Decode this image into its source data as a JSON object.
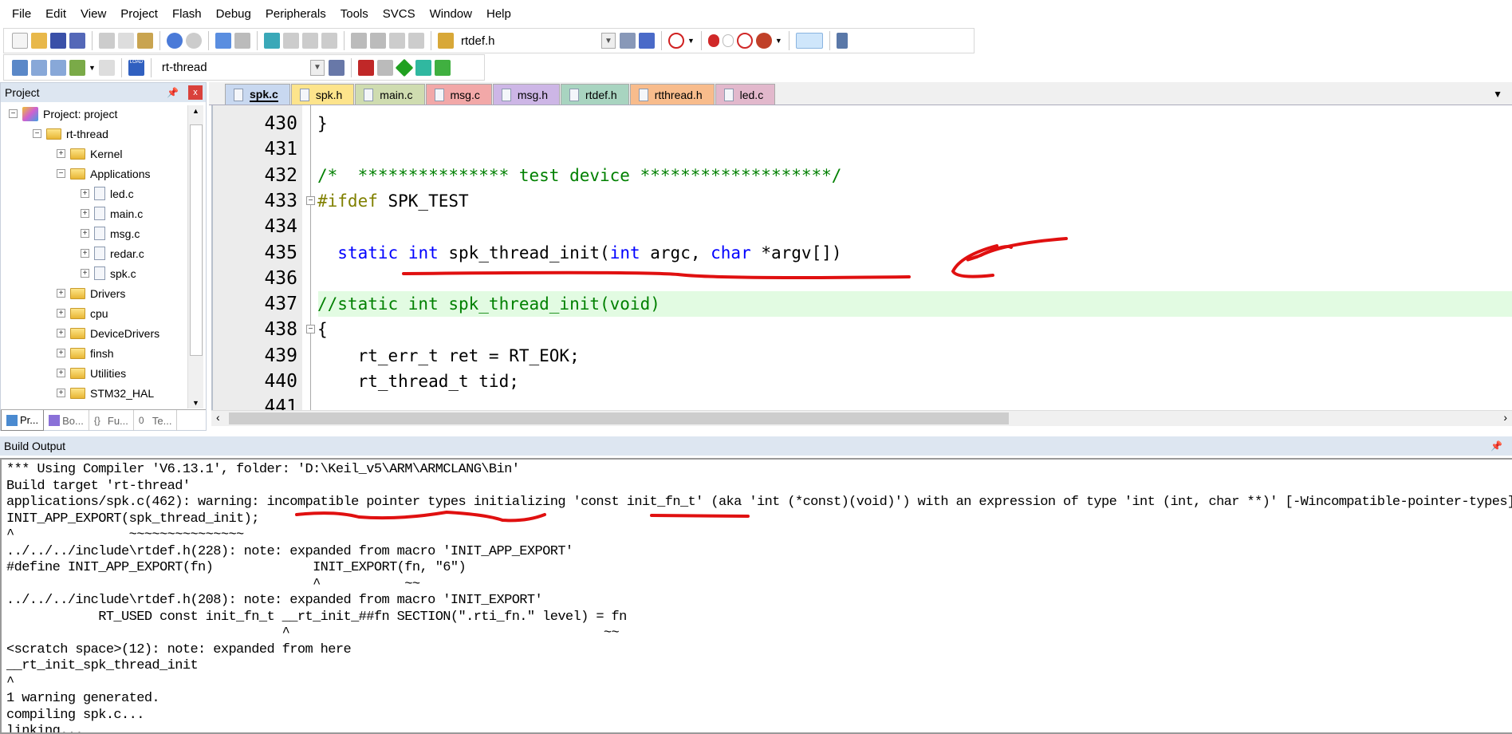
{
  "menu": [
    "File",
    "Edit",
    "View",
    "Project",
    "Flash",
    "Debug",
    "Peripherals",
    "Tools",
    "SVCS",
    "Window",
    "Help"
  ],
  "toolbar1": {
    "find_combo": "rtdef.h"
  },
  "toolbar2": {
    "target_combo": "rt-thread",
    "load_label": "LOAD"
  },
  "project_panel": {
    "title": "Project",
    "close": "x",
    "tree": [
      {
        "label": "Project: project",
        "level": 0,
        "expanded": true,
        "type": "project"
      },
      {
        "label": "rt-thread",
        "level": 1,
        "expanded": true,
        "type": "target"
      },
      {
        "label": "Kernel",
        "level": 2,
        "expanded": false,
        "type": "folder"
      },
      {
        "label": "Applications",
        "level": 2,
        "expanded": true,
        "type": "folder"
      },
      {
        "label": "led.c",
        "level": 3,
        "expanded": false,
        "type": "file"
      },
      {
        "label": "main.c",
        "level": 3,
        "expanded": false,
        "type": "file"
      },
      {
        "label": "msg.c",
        "level": 3,
        "expanded": false,
        "type": "file"
      },
      {
        "label": "redar.c",
        "level": 3,
        "expanded": false,
        "type": "file"
      },
      {
        "label": "spk.c",
        "level": 3,
        "expanded": false,
        "type": "file"
      },
      {
        "label": "Drivers",
        "level": 2,
        "expanded": false,
        "type": "folder"
      },
      {
        "label": "cpu",
        "level": 2,
        "expanded": false,
        "type": "folder"
      },
      {
        "label": "DeviceDrivers",
        "level": 2,
        "expanded": false,
        "type": "folder"
      },
      {
        "label": "finsh",
        "level": 2,
        "expanded": false,
        "type": "folder"
      },
      {
        "label": "Utilities",
        "level": 2,
        "expanded": false,
        "type": "folder"
      },
      {
        "label": "STM32_HAL",
        "level": 2,
        "expanded": false,
        "type": "folder"
      }
    ],
    "tabs": [
      {
        "label": "Pr...",
        "icon": "project-icon"
      },
      {
        "label": "Bo...",
        "icon": "books-icon"
      },
      {
        "label": "Fu...",
        "icon": "functions-icon",
        "glyph": "{}"
      },
      {
        "label": "Te...",
        "icon": "templates-icon",
        "glyph": "0"
      }
    ]
  },
  "editor": {
    "tabs": [
      {
        "label": "spk.c",
        "color": "#c8d8f0",
        "active": true
      },
      {
        "label": "spk.h",
        "color": "#fde48c"
      },
      {
        "label": "main.c",
        "color": "#cfdcb0"
      },
      {
        "label": "msg.c",
        "color": "#f2a8a8"
      },
      {
        "label": "msg.h",
        "color": "#cdb6e6"
      },
      {
        "label": "rtdef.h",
        "color": "#a8d4c0"
      },
      {
        "label": "rtthread.h",
        "color": "#f8bc8c"
      },
      {
        "label": "led.c",
        "color": "#e2b8cc"
      }
    ],
    "lines": [
      {
        "n": "430",
        "tokens": [
          {
            "t": "}"
          }
        ]
      },
      {
        "n": "431",
        "tokens": []
      },
      {
        "n": "432",
        "tokens": [
          {
            "t": "/*  *************** test device *******************/",
            "c": "cm"
          }
        ]
      },
      {
        "n": "433",
        "tokens": [
          {
            "t": "#ifdef",
            "c": "pp"
          },
          {
            "t": " SPK_TEST"
          }
        ],
        "fold": true
      },
      {
        "n": "434",
        "tokens": []
      },
      {
        "n": "435",
        "tokens": [
          {
            "t": "  "
          },
          {
            "t": "static",
            "c": "kw"
          },
          {
            "t": " "
          },
          {
            "t": "int",
            "c": "kw"
          },
          {
            "t": " spk_thread_init("
          },
          {
            "t": "int",
            "c": "kw"
          },
          {
            "t": " argc, "
          },
          {
            "t": "char",
            "c": "kw"
          },
          {
            "t": " *argv[])"
          }
        ]
      },
      {
        "n": "436",
        "tokens": []
      },
      {
        "n": "437",
        "tokens": [
          {
            "t": "//static int spk_thread_init(void)",
            "c": "cm"
          }
        ]
      },
      {
        "n": "438",
        "tokens": [
          {
            "t": "{"
          }
        ],
        "fold": true
      },
      {
        "n": "439",
        "tokens": [
          {
            "t": "    rt_err_t ret = RT_EOK;"
          }
        ]
      },
      {
        "n": "440",
        "tokens": [
          {
            "t": "    rt_thread_t tid;"
          }
        ]
      },
      {
        "n": "441",
        "tokens": []
      }
    ]
  },
  "build_output": {
    "title": "Build Output",
    "lines": [
      "*** Using Compiler 'V6.13.1', folder: 'D:\\Keil_v5\\ARM\\ARMCLANG\\Bin'",
      "Build target 'rt-thread'",
      "applications/spk.c(462): warning: incompatible pointer types initializing 'const init_fn_t' (aka 'int (*const)(void)') with an expression of type 'int (int, char **)' [-Wincompatible-pointer-types]",
      "INIT_APP_EXPORT(spk_thread_init);",
      "^               ~~~~~~~~~~~~~~~",
      "../../../include\\rtdef.h(228): note: expanded from macro 'INIT_APP_EXPORT'",
      "#define INIT_APP_EXPORT(fn)             INIT_EXPORT(fn, \"6\")",
      "                                        ^           ~~",
      "../../../include\\rtdef.h(208): note: expanded from macro 'INIT_EXPORT'",
      "            RT_USED const init_fn_t __rt_init_##fn SECTION(\".rti_fn.\" level) = fn",
      "                                    ^                                         ~~",
      "<scratch space>(12): note: expanded from here",
      "__rt_init_spk_thread_init",
      "^",
      "1 warning generated.",
      "compiling spk.c...",
      "linking..."
    ]
  },
  "annotation_color": "#e01010"
}
